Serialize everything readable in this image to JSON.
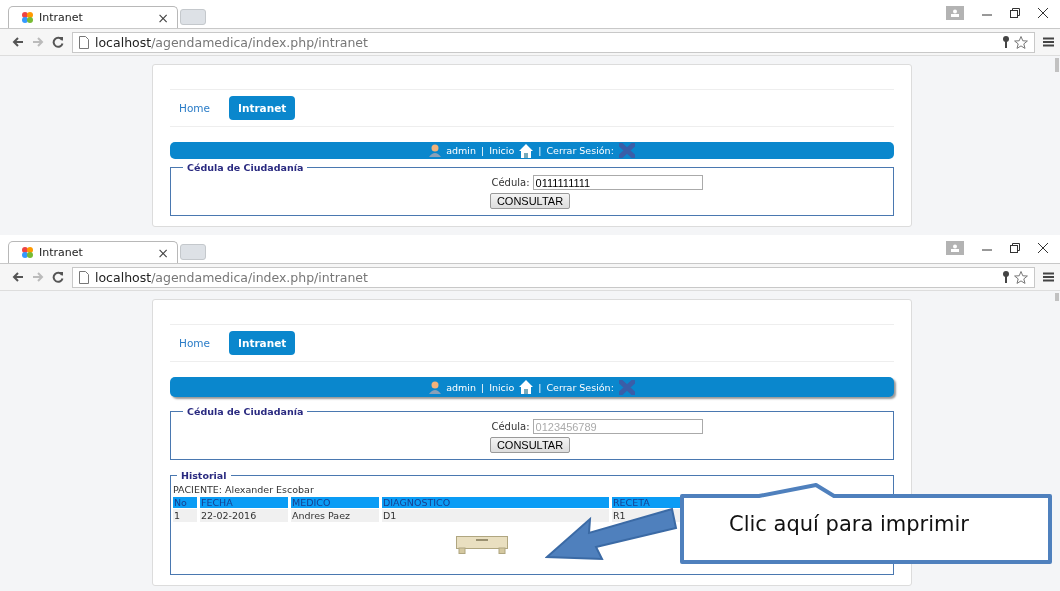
{
  "windows": [
    {
      "tab": {
        "title": "Intranet",
        "close": "×"
      },
      "address": {
        "host": "localhost",
        "path": "/agendamedica/index.php/intranet"
      },
      "nav": [
        {
          "label": "Home",
          "selected": false
        },
        {
          "label": "Intranet",
          "selected": true
        }
      ],
      "user_bar": {
        "user": "admin",
        "separator_1": "|",
        "home": "Inicio",
        "separator_2": "|",
        "logout": "Cerrar Sesión:"
      },
      "cedula_section": {
        "legend": "Cédula de Ciudadanía",
        "label": "Cédula:",
        "value": "0111111111",
        "button": "CONSULTAR"
      }
    },
    {
      "tab": {
        "title": "Intranet",
        "close": "×"
      },
      "address": {
        "host": "localhost",
        "path": "/agendamedica/index.php/intranet"
      },
      "nav": [
        {
          "label": "Home",
          "selected": false
        },
        {
          "label": "Intranet",
          "selected": true
        }
      ],
      "user_bar": {
        "user": "admin",
        "separator_1": "|",
        "home": "Inicio",
        "separator_2": "|",
        "logout": "Cerrar Sesión:"
      },
      "cedula_section": {
        "legend": "Cédula de Ciudadanía",
        "label": "Cédula:",
        "placeholder": "0123456789",
        "button": "CONSULTAR"
      },
      "historial": {
        "legend": "Historial",
        "patient": "PACIENTE: Alexander Escobar",
        "columns": [
          "No",
          "FECHA",
          "MEDICO",
          "DIAGNOSTICO",
          "RECETA"
        ],
        "rows": [
          [
            "1",
            "22-02-2016",
            "Andres Paez",
            "D1",
            "R1"
          ]
        ]
      },
      "callout": {
        "text": "Clic aquí para imprimir"
      }
    }
  ]
}
